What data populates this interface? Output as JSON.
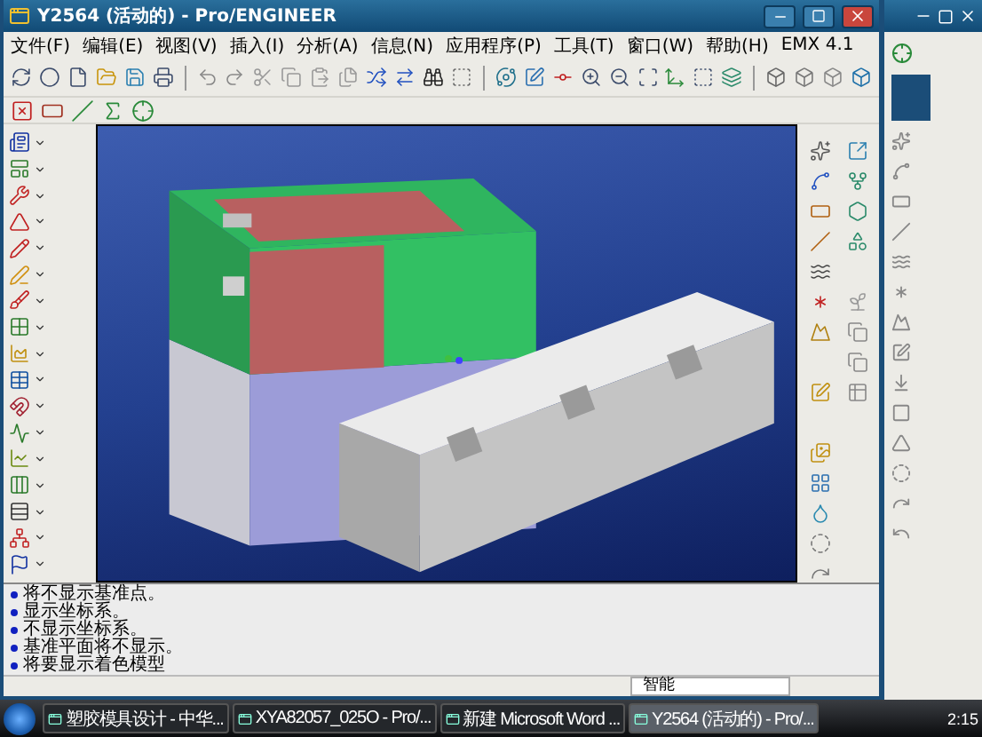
{
  "window": {
    "title": "Y2564 (活动的) - Pro/ENGINEER"
  },
  "menu": [
    "文件(F)",
    "编辑(E)",
    "视图(V)",
    "插入(I)",
    "分析(A)",
    "信息(N)",
    "应用程序(P)",
    "工具(T)",
    "窗口(W)",
    "帮助(H)",
    "EMX 4.1"
  ],
  "messages": [
    "将不显示基准点。",
    "显示坐标系。",
    "不显示坐标系。",
    "基准平面将不显示。",
    "将要显示着色模型"
  ],
  "status_bar": {
    "filter": "智能"
  },
  "taskbar": {
    "items": [
      {
        "label": "塑胶模具设计 - 中华...",
        "selected": false
      },
      {
        "label": "XYA82057_025O - Pro/...",
        "selected": false
      },
      {
        "label": "新建 Microsoft Word ...",
        "selected": false
      },
      {
        "label": "Y2564 (活动的) - Pro/...",
        "selected": true
      }
    ],
    "clock": "2:15"
  }
}
